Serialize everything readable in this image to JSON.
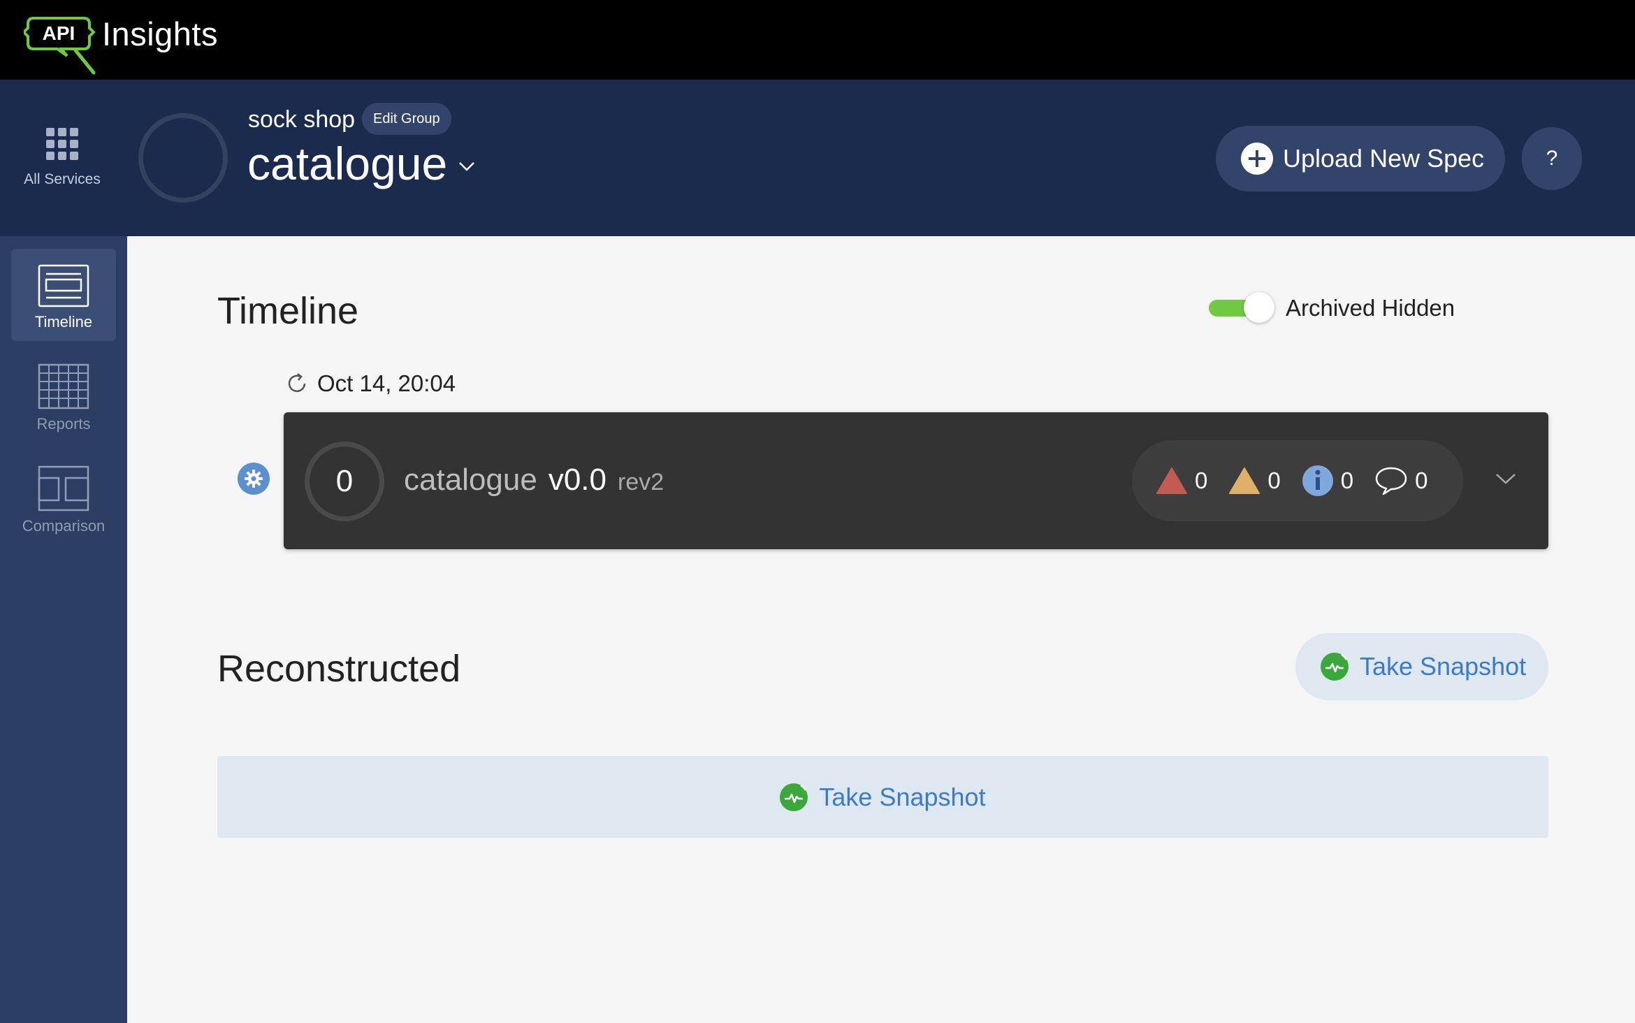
{
  "app": {
    "logo_badge": "API",
    "logo_text": "Insights",
    "colors": {
      "accent_green": "#6fc941",
      "header_bg": "#1b2b4d",
      "sidebar_bg": "#2b3d63",
      "link_blue": "#3a7cc8"
    }
  },
  "header": {
    "all_services_label": "All Services",
    "group_name": "sock shop",
    "edit_group_label": "Edit Group",
    "service_name": "catalogue",
    "upload_label": "Upload New Spec",
    "help_label": "?"
  },
  "sidebar": {
    "items": [
      {
        "label": "Timeline",
        "icon": "timeline-icon",
        "active": true
      },
      {
        "label": "Reports",
        "icon": "reports-icon",
        "active": false
      },
      {
        "label": "Comparison",
        "icon": "comparison-icon",
        "active": false
      }
    ]
  },
  "timeline": {
    "title": "Timeline",
    "toggle_label": "Archived Hidden",
    "toggle_on": true,
    "entry": {
      "timestamp": "Oct 14, 20:04",
      "score": "0",
      "name": "catalogue",
      "version": "v0.0",
      "revision": "rev2",
      "counts": {
        "errors": "0",
        "warnings": "0",
        "info": "0",
        "comments": "0"
      }
    }
  },
  "reconstructed": {
    "title": "Reconstructed",
    "snapshot_button_label": "Take Snapshot",
    "snapshot_bar_label": "Take Snapshot"
  }
}
